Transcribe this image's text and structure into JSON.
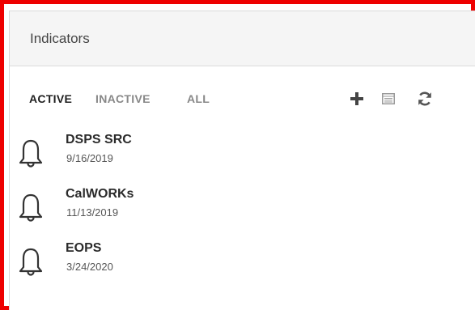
{
  "panel": {
    "title": "Indicators"
  },
  "tabs": [
    {
      "label": "ACTIVE",
      "selected": true
    },
    {
      "label": "INACTIVE",
      "selected": false
    },
    {
      "label": "ALL",
      "selected": false
    }
  ],
  "toolbar": {
    "icons": [
      "plus-icon",
      "table-icon",
      "refresh-icon"
    ]
  },
  "indicators": [
    {
      "name": "DSPS SRC",
      "date": "9/16/2019",
      "icon": "bell-icon"
    },
    {
      "name": "CalWORKs",
      "date": "11/13/2019",
      "icon": "bell-icon"
    },
    {
      "name": "EOPS",
      "date": "3/24/2020",
      "icon": "bell-icon"
    }
  ],
  "colors": {
    "frame_border": "#ee0000",
    "header_bg": "#f5f5f5",
    "active_tab": "#1f1f1f",
    "inactive_tab": "#888888"
  }
}
